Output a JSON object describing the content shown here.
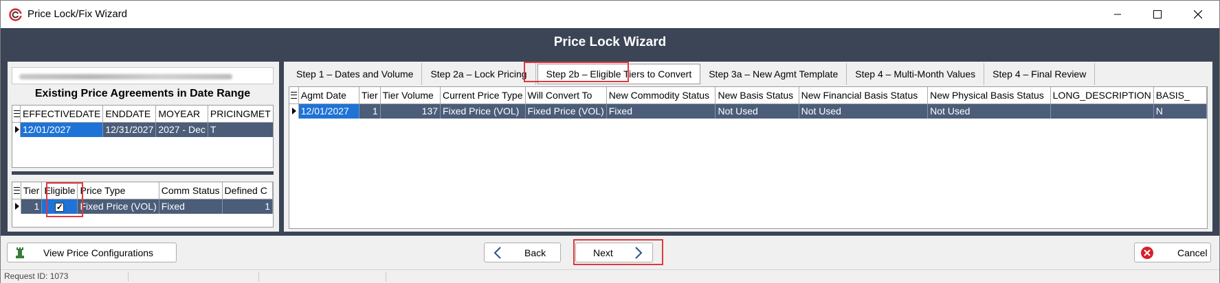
{
  "window": {
    "title": "Price Lock/Fix Wizard"
  },
  "header": {
    "title": "Price Lock Wizard"
  },
  "left": {
    "section_title": "Existing Price Agreements in Date Range",
    "agreements": {
      "columns": [
        "EFFECTIVEDATE",
        "ENDDATE",
        "MOYEAR",
        "PRICINGMET"
      ],
      "rows": [
        [
          "12/01/2027",
          "12/31/2027",
          "2027 - Dec",
          "T"
        ]
      ]
    },
    "tiers": {
      "columns": [
        "Tier",
        "Eligible",
        "Price Type",
        "Comm Status",
        "Defined C"
      ],
      "rows": [
        {
          "tier": "1",
          "eligible": true,
          "price_type": "Fixed Price (VOL)",
          "comm_status": "Fixed",
          "defined": "1"
        }
      ]
    }
  },
  "tabs": [
    "Step 1 – Dates and Volume",
    "Step 2a – Lock Pricing",
    "Step 2b – Eligible Tiers to Convert",
    "Step 3a – New Agmt Template",
    "Step 4 – Multi-Month Values",
    "Step 4 – Final Review"
  ],
  "active_tab_index": 2,
  "main_grid": {
    "columns": [
      "Agmt Date",
      "Tier",
      "Tier Volume",
      "Current Price Type",
      "Will Convert To",
      "New Commodity Status",
      "New Basis Status",
      "New Financial Basis Status",
      "New Physical Basis Status",
      "LONG_DESCRIPTION",
      "BASIS_"
    ],
    "rows": [
      [
        "12/01/2027",
        "1",
        "137",
        "Fixed Price (VOL)",
        "Fixed Price (VOL)",
        "Fixed",
        "Not Used",
        "Not Used",
        "Not Used",
        "",
        "N"
      ]
    ]
  },
  "buttons": {
    "view_price_configurations": "View Price Configurations",
    "back": "Back",
    "next": "Next",
    "cancel": "Cancel"
  },
  "status": {
    "text": "Request ID: 1073"
  },
  "colors": {
    "header_bg": "#3b4556",
    "selected_row": "#4b5d78",
    "selected_cell": "#1e73d6",
    "highlight": "#e0383c",
    "cancel_red": "#d6202a"
  }
}
